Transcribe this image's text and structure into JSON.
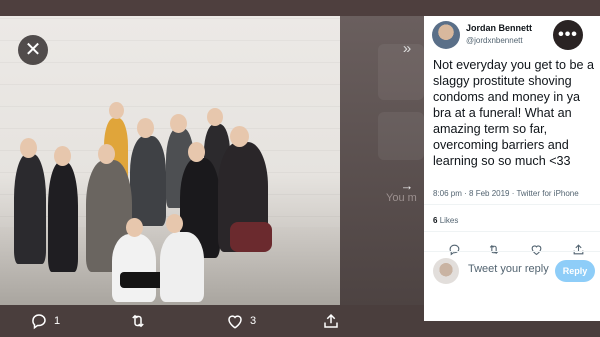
{
  "media_viewer": {
    "close_icon": "close-icon",
    "expand_icon": "chevrons-right-icon",
    "next_icon": "arrow-right-icon",
    "background_hint_text": "You m"
  },
  "actions": {
    "reply_count": "1",
    "retweet_count": "",
    "like_count": "3",
    "icons": [
      "reply-icon",
      "retweet-icon",
      "like-icon",
      "share-icon"
    ]
  },
  "tweet": {
    "author_name": "Jordan Bennett",
    "author_handle": "@jordxnbennett",
    "text": "Not everyday you get to be a slaggy prostitute shoving condoms and money in ya bra at a funeral! What an amazing term so far, overcoming barriers and learning so so much <33",
    "timestamp": "8:06 pm · 8 Feb 2019 · Twitter for iPhone",
    "likes_count": "6",
    "likes_label": "Likes",
    "reply_placeholder": "Tweet your reply",
    "reply_button_label": "Reply"
  },
  "colors": {
    "frame": "#4a3e3d",
    "reply_button": "#8ecdf8",
    "more_button": "#2a2323"
  }
}
